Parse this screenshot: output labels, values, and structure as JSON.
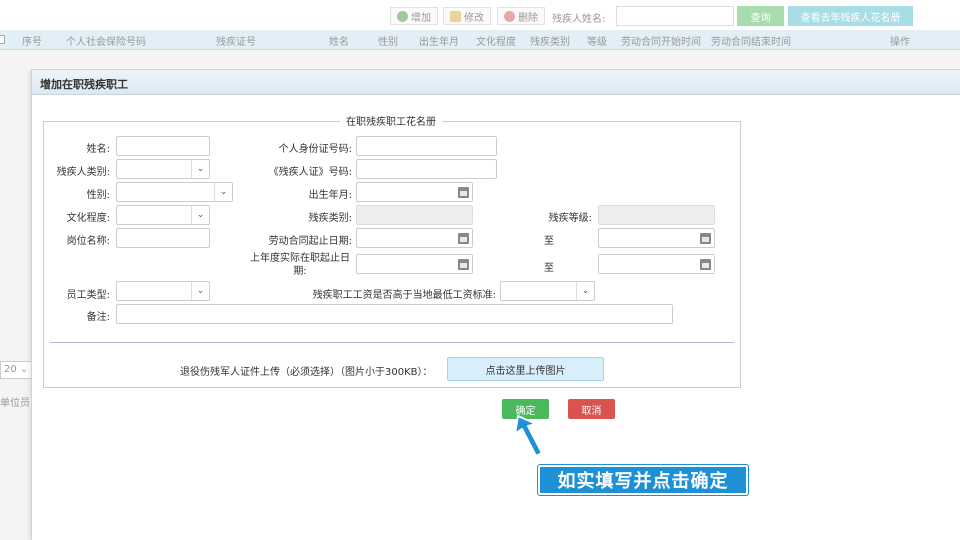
{
  "toolbar": {
    "add_label": "增加",
    "edit_label": "修改",
    "delete_label": "删除",
    "search_label": "残疾人姓名:",
    "search_value": "",
    "query_label": "查询",
    "view_label": "查看去年残疾人花名册"
  },
  "grid": {
    "columns": [
      "序号",
      "个人社会保险号码",
      "残疾证号",
      "姓名",
      "性别",
      "出生年月",
      "文化程度",
      "残疾类别",
      "等级",
      "劳动合同开始时间",
      "劳动合同结束时间",
      "操作"
    ]
  },
  "background": {
    "page_size": "20",
    "side_text": "单位员"
  },
  "dialog": {
    "title": "增加在职残疾职工",
    "legend": "在职残疾职工花名册",
    "labels": {
      "name": "姓名:",
      "id_number": "个人身份证号码:",
      "disability_category": "残疾人类别:",
      "disability_cert": "《残疾人证》号码:",
      "gender": "性别:",
      "birth": "出生年月:",
      "education": "文化程度:",
      "disability_type": "残疾类别:",
      "disability_level": "残疾等级:",
      "position": "岗位名称:",
      "contract_period": "劳动合同起止日期:",
      "to1": "至",
      "actual_period": "上年度实际在职起止日期:",
      "to2": "至",
      "employee_type": "员工类型:",
      "wage_question": "残疾职工工资是否高于当地最低工资标准:",
      "remarks": "备注:"
    },
    "upload_label": "退役伤残军人证件上传（必须选择）（图片小于300KB）：",
    "upload_button": "点击这里上传图片",
    "ok_button": "确定",
    "cancel_button": "取消"
  },
  "annotation": {
    "text": "如实填写并点击确定"
  },
  "colors": {
    "ok": "#4cb85c",
    "cancel": "#d9534f",
    "banner": "#1e90d6"
  }
}
